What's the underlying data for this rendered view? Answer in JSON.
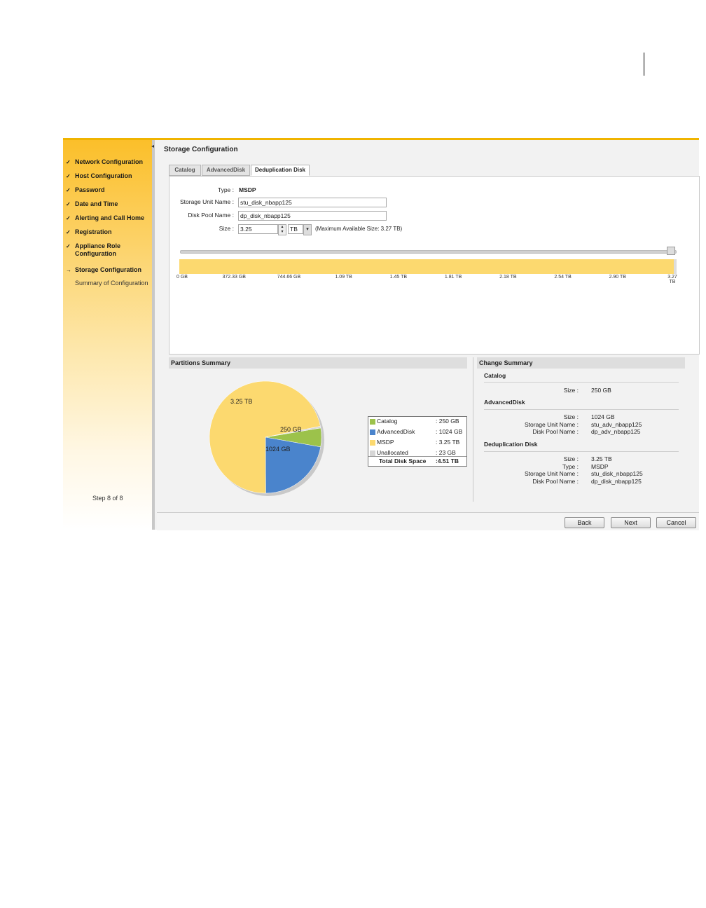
{
  "sidebar": {
    "items": [
      {
        "label": "Network Configuration",
        "marker": "✓",
        "style": "done"
      },
      {
        "label": "Host Configuration",
        "marker": "✓",
        "style": "done"
      },
      {
        "label": "Password",
        "marker": "✓",
        "style": "done"
      },
      {
        "label": "Date and Time",
        "marker": "✓",
        "style": "done"
      },
      {
        "label": "Alerting and Call Home",
        "marker": "✓",
        "style": "done"
      },
      {
        "label": "Registration",
        "marker": "✓",
        "style": "done"
      },
      {
        "label": "Appliance Role Configuration",
        "marker": "✓",
        "style": "done"
      },
      {
        "label": "Storage Configuration",
        "marker": "→",
        "style": "current"
      },
      {
        "label": "Summary of Configuration",
        "marker": "",
        "style": "plain"
      }
    ],
    "step_text": "Step 8 of 8",
    "collapse_icon": "◂"
  },
  "main": {
    "title": "Storage Configuration",
    "tabs": [
      {
        "label": "Catalog",
        "active": false
      },
      {
        "label": "AdvancedDisk",
        "active": false
      },
      {
        "label": "Deduplication Disk",
        "active": true
      }
    ]
  },
  "form": {
    "type_label": "Type :",
    "type_value": "MSDP",
    "stu_label": "Storage Unit Name :",
    "stu_value": "stu_disk_nbapp125",
    "dp_label": "Disk Pool Name :",
    "dp_value": "dp_disk_nbapp125",
    "size_label": "Size :",
    "size_value": "3.25",
    "unit_value": "TB",
    "max_info": "(Maximum Available Size: 3.27 TB)",
    "spin_up_icon": "▴",
    "spin_down_icon": "▾",
    "dropdown_icon": "▾"
  },
  "bar": {
    "fill_fraction": 0.994,
    "labels": [
      "0 GB",
      "372.33 GB",
      "744.66 GB",
      "1.09 TB",
      "1.45 TB",
      "1.81 TB",
      "2.18 TB",
      "2.54 TB",
      "2.90 TB",
      "3.27 TB"
    ],
    "colors": {
      "fill": "#fcd96f",
      "empty": "#dddddd"
    }
  },
  "partitions": {
    "header": "Partitions Summary",
    "legend": [
      {
        "name": "Catalog",
        "value": ": 250 GB",
        "color": "#9cc24b"
      },
      {
        "name": "AdvancedDisk",
        "value": ": 1024 GB",
        "color": "#4a84cc"
      },
      {
        "name": "MSDP",
        "value": ": 3.25 TB",
        "color": "#fcd96f"
      },
      {
        "name": "Unallocated",
        "value": ": 23 GB",
        "color": "#d6d6d6"
      }
    ],
    "total_label": "Total Disk Space",
    "total_value": ":4.51 TB",
    "pie_labels": {
      "msdp": "3.25 TB",
      "catalog": "250 GB",
      "advanced": "1024 GB"
    }
  },
  "chart_data": {
    "type": "pie",
    "categories": [
      "Catalog",
      "AdvancedDisk",
      "MSDP",
      "Unallocated"
    ],
    "values": [
      250,
      1024,
      3328,
      23
    ],
    "units": "GB",
    "colors": [
      "#9cc24b",
      "#4a84cc",
      "#fcd96f",
      "#d6d6d6"
    ]
  },
  "change_summary": {
    "header": "Change Summary",
    "catalog": {
      "title": "Catalog",
      "size_k": "Size :",
      "size_v": "250 GB"
    },
    "advanced": {
      "title": "AdvancedDisk",
      "size_k": "Size :",
      "size_v": "1024 GB",
      "stu_k": "Storage Unit Name :",
      "stu_v": "stu_adv_nbapp125",
      "dp_k": "Disk Pool Name :",
      "dp_v": "dp_adv_nbapp125"
    },
    "dedup": {
      "title": "Deduplication Disk",
      "size_k": "Size :",
      "size_v": "3.25 TB",
      "type_k": "Type :",
      "type_v": "MSDP",
      "stu_k": "Storage Unit Name :",
      "stu_v": "stu_disk_nbapp125",
      "dp_k": "Disk Pool Name :",
      "dp_v": "dp_disk_nbapp125"
    }
  },
  "footer": {
    "back_label": "Back",
    "next_label": "Next",
    "cancel_label": "Cancel"
  }
}
